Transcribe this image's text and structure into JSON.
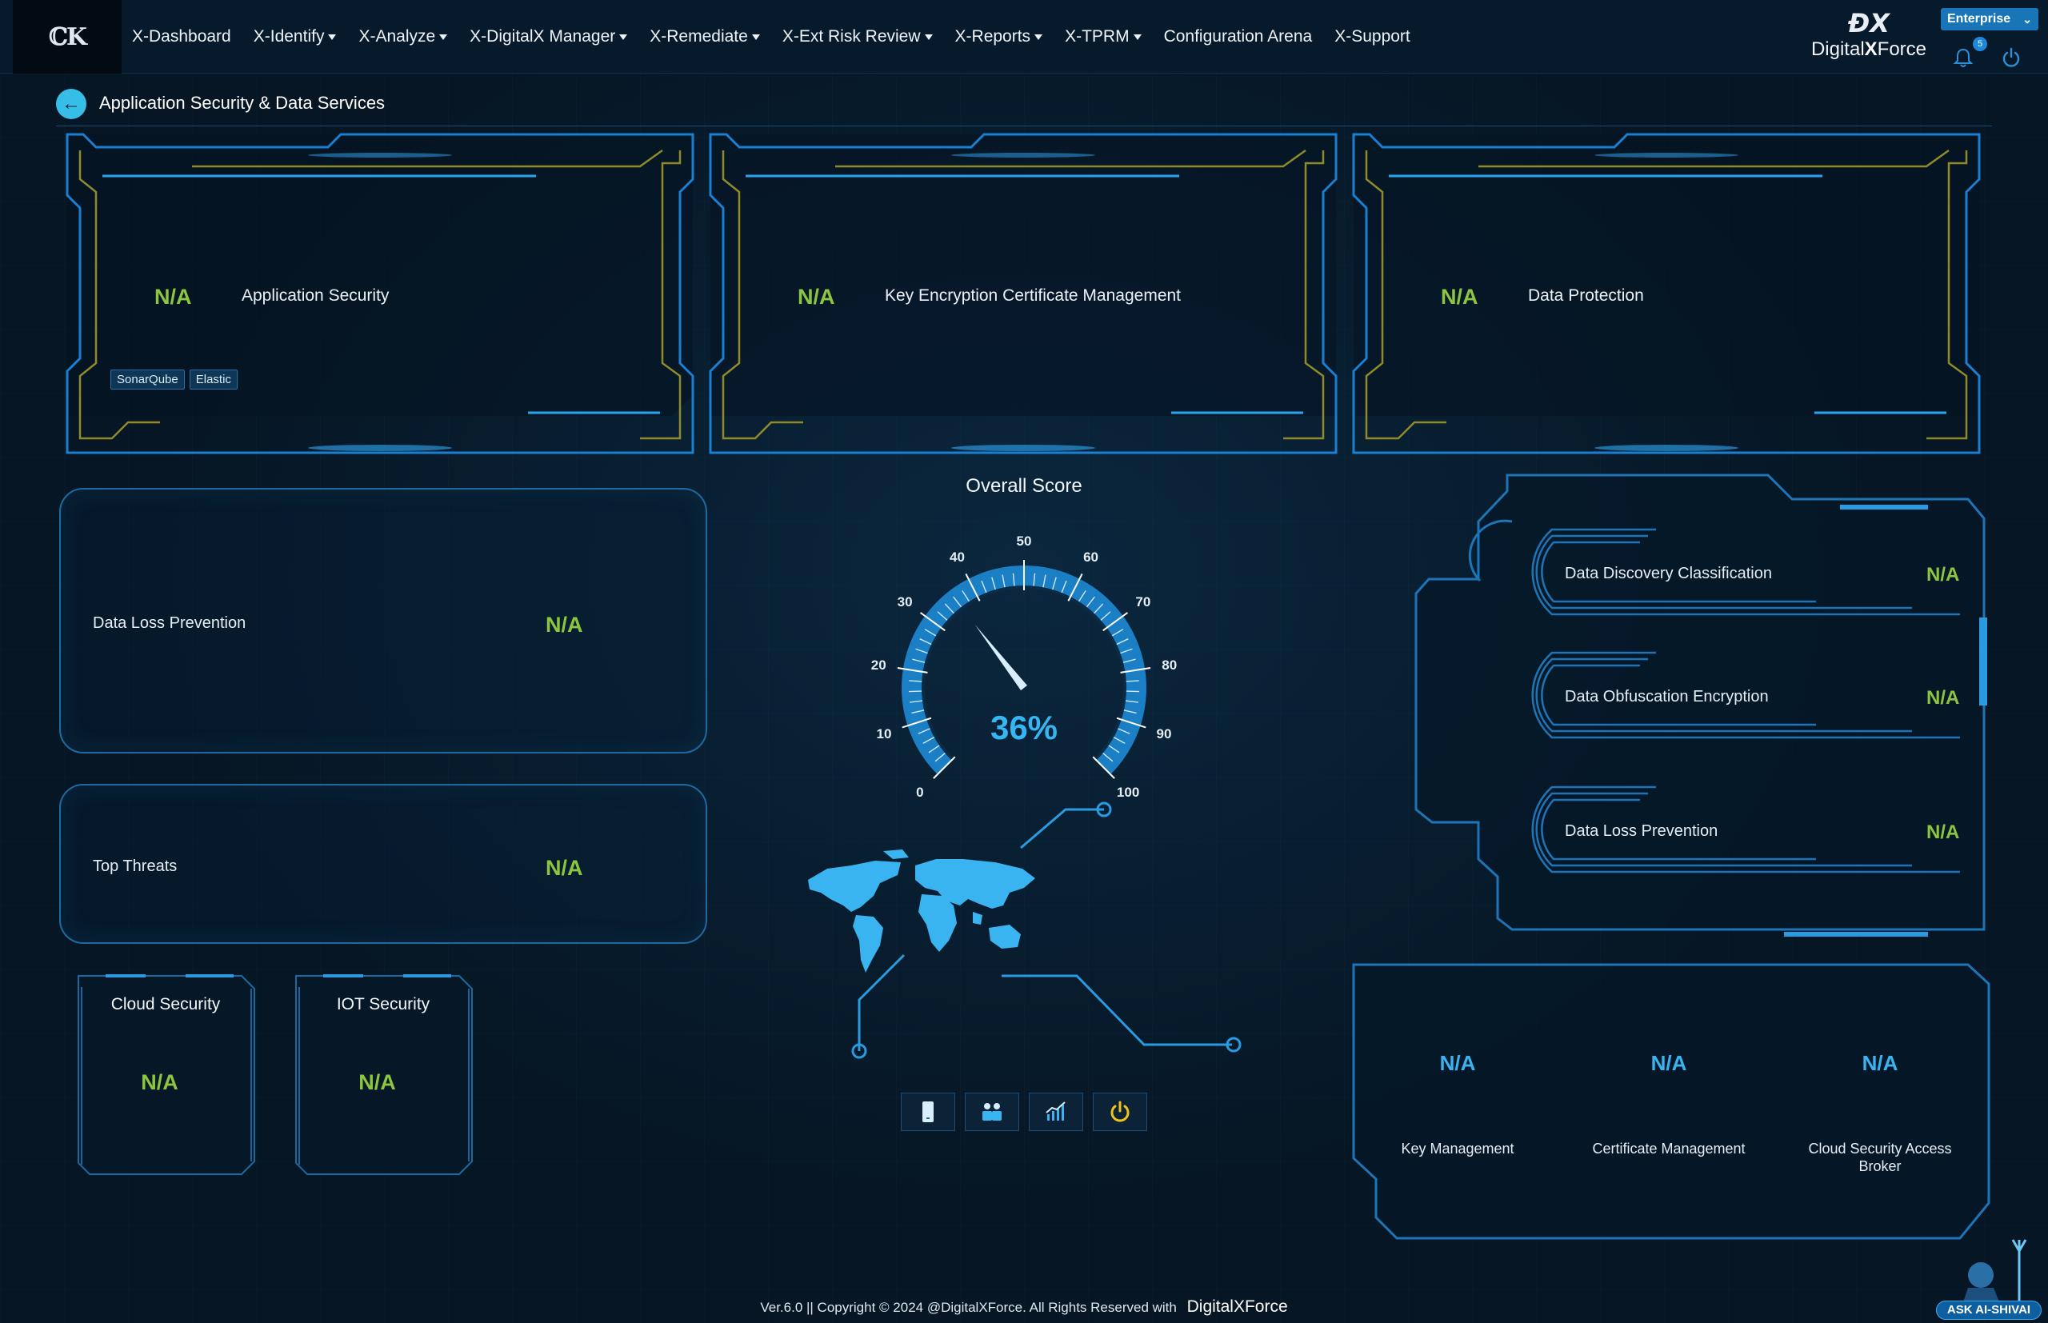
{
  "nav": {
    "items": [
      {
        "label": "X-Dashboard",
        "dropdown": false
      },
      {
        "label": "X-Identify",
        "dropdown": true
      },
      {
        "label": "X-Analyze",
        "dropdown": true
      },
      {
        "label": "X-DigitalX Manager",
        "dropdown": true
      },
      {
        "label": "X-Remediate",
        "dropdown": true
      },
      {
        "label": "X-Ext Risk Review",
        "dropdown": true
      },
      {
        "label": "X-Reports",
        "dropdown": true
      },
      {
        "label": "X-TPRM",
        "dropdown": true
      },
      {
        "label": "Configuration Arena",
        "dropdown": false
      },
      {
        "label": "X-Support",
        "dropdown": false
      }
    ],
    "brand_text_1": "Digital",
    "brand_text_2": "X",
    "brand_text_3": "Force",
    "plan_select": "Enterprise",
    "notification_count": "5"
  },
  "page": {
    "title": "Application Security & Data Services"
  },
  "top_panels": [
    {
      "score": "N/A",
      "label": "Application Security",
      "tags": [
        "SonarQube",
        "Elastic"
      ]
    },
    {
      "score": "N/A",
      "label": "Key Encryption Certificate Management"
    },
    {
      "score": "N/A",
      "label": "Data Protection"
    }
  ],
  "left_boxes": {
    "dlp": {
      "label": "Data Loss Prevention",
      "score": "N/A"
    },
    "threats": {
      "label": "Top Threats",
      "score": "N/A"
    }
  },
  "small_cards": [
    {
      "label": "Cloud Security",
      "score": "N/A"
    },
    {
      "label": "IOT Security",
      "score": "N/A"
    }
  ],
  "gauge": {
    "title": "Overall Score",
    "value": 36,
    "display": "36%",
    "ticks": [
      "0",
      "10",
      "20",
      "30",
      "40",
      "50",
      "60",
      "70",
      "80",
      "90",
      "100"
    ]
  },
  "right_top": [
    {
      "label": "Data Discovery Classification",
      "score": "N/A"
    },
    {
      "label": "Data Obfuscation Encryption",
      "score": "N/A"
    },
    {
      "label": "Data Loss Prevention",
      "score": "N/A"
    }
  ],
  "right_bottom": [
    {
      "score": "N/A",
      "label": "Key Management"
    },
    {
      "score": "N/A",
      "label": "Certificate Management"
    },
    {
      "score": "N/A",
      "label": "Cloud Security Access Broker"
    }
  ],
  "footer": {
    "text": "Ver.6.0 || Copyright © 2024 @DigitalXForce. All Rights Reserved with",
    "brand": "DigitalXForce"
  },
  "ask_ai": {
    "label": "ASK AI-SHIVAI"
  },
  "colors": {
    "background": "#061624",
    "accent": "#1e88d8",
    "score_green": "#8cc63f",
    "gold": "#9a8f2a"
  }
}
